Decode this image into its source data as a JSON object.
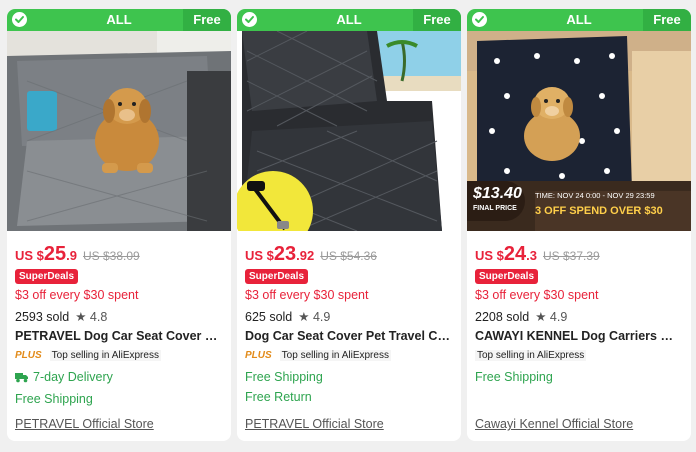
{
  "accent_green": "#3ec44e",
  "price_red": "#e8223a",
  "products": [
    {
      "badge_all": "ALL",
      "badge_free": "Free",
      "currency": "US $",
      "price_int": "25",
      "price_dec": ".9",
      "orig_price": "US $38.09",
      "superdeals": "SuperDeals",
      "offer": "$3 off every $30 spent",
      "sold": "2593 sold",
      "rating": "★ 4.8",
      "title": "PETRAVEL Dog Car Seat Cover Wat...",
      "plus": "PLUS",
      "top_selling": "Top selling in AliExpress",
      "delivery": "7-day Delivery",
      "shipping": "Free Shipping",
      "store": "PETRAVEL Official Store",
      "image_icon": "dog-on-car-seat-cover"
    },
    {
      "badge_all": "ALL",
      "badge_free": "Free",
      "currency": "US $",
      "price_int": "23",
      "price_dec": ".92",
      "orig_price": "US $54.36",
      "superdeals": "SuperDeals",
      "offer": "$3 off every $30 spent",
      "sold": "625 sold",
      "rating": "★ 4.9",
      "title": "Dog Car Seat Cover Pet Travel Carr...",
      "plus": "PLUS",
      "top_selling": "Top selling in AliExpress",
      "shipping": "Free Shipping",
      "return": "Free Return",
      "store": "PETRAVEL Official Store",
      "image_icon": "quilted-car-seat-cover"
    },
    {
      "badge_all": "ALL",
      "badge_free": "Free",
      "currency": "US $",
      "price_int": "24",
      "price_dec": ".3",
      "orig_price": "US $37.39",
      "superdeals": "SuperDeals",
      "offer": "$3 off every $30 spent",
      "sold": "2208 sold",
      "rating": "★ 4.9",
      "title": "CAWAYI KENNEL Dog Carriers Wat...",
      "top_selling": "Top selling in AliExpress",
      "shipping": "Free Shipping",
      "store": "Cawayi Kennel Official Store",
      "image_icon": "dog-on-paw-print-seat-cover",
      "promo_price": "$13.40",
      "promo_label": "FINAL PRICE",
      "promo_time": "TIME: NOV 24 0:00 - NOV 29 23:59",
      "promo_deal": "3 OFF SPEND OVER $30"
    }
  ]
}
